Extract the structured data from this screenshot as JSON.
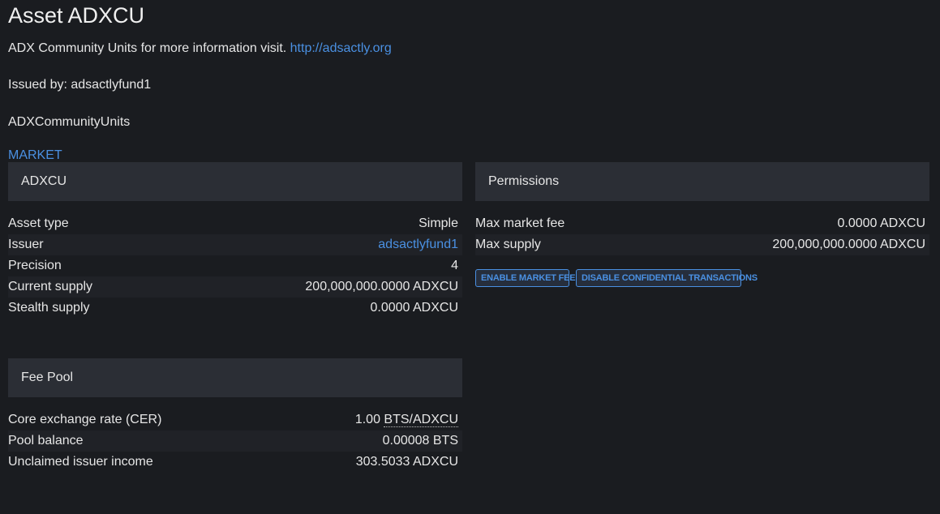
{
  "asset": {
    "title": "Asset ADXCU",
    "description": "ADX Community Units for more information visit.",
    "description_link": "http://adsactly.org",
    "issued_by": "Issued by: adsactlyfund1",
    "short_name": "ADXCommunityUnits",
    "market_link": "MARKET"
  },
  "summary": {
    "header": "ADXCU",
    "rows": [
      {
        "label": "Asset type",
        "value": "Simple"
      },
      {
        "label": "Issuer",
        "value": "adsactlyfund1"
      },
      {
        "label": "Precision",
        "value": "4"
      },
      {
        "label": "Current supply",
        "value": "200,000,000.0000 ADXCU"
      },
      {
        "label": "Stealth supply",
        "value": "0.0000 ADXCU"
      }
    ]
  },
  "permissions": {
    "header": "Permissions",
    "rows": [
      {
        "label": "Max market fee",
        "value": "0.0000 ADXCU"
      },
      {
        "label": "Max supply",
        "value": "200,000,000.0000 ADXCU"
      }
    ],
    "buttons": [
      "ENABLE MARKET FEE",
      "DISABLE CONFIDENTIAL TRANSACTIONS"
    ]
  },
  "fee_pool": {
    "header": "Fee Pool",
    "rows": [
      {
        "label": "Core exchange rate (CER)",
        "value_prefix": "1.00 ",
        "value": "BTS/ADXCU"
      },
      {
        "label": "Pool balance",
        "value": "0.00008 BTS"
      },
      {
        "label": "Unclaimed issuer income",
        "value": "303.5033 ADXCU"
      }
    ]
  },
  "colors": {
    "background": "#1a1c20",
    "panel_header": "#2b2e35",
    "accent": "#4a90e2"
  }
}
